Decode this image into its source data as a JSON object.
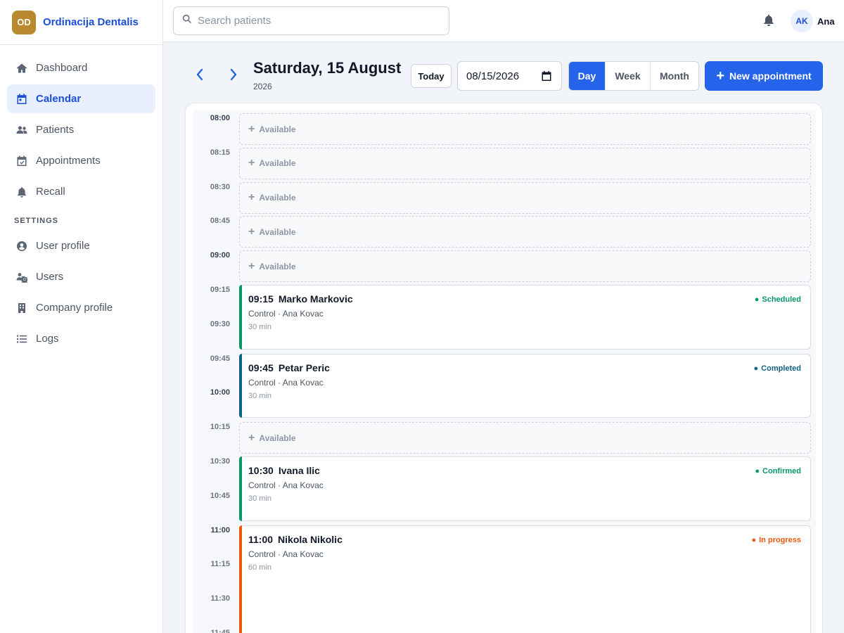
{
  "brand": {
    "initials": "OD",
    "name": "Ordinacija Dentalis"
  },
  "nav": {
    "items": [
      {
        "label": "Dashboard",
        "icon": "home-icon"
      },
      {
        "label": "Calendar",
        "icon": "calendar-icon",
        "active": true
      },
      {
        "label": "Patients",
        "icon": "users-icon"
      },
      {
        "label": "Appointments",
        "icon": "calendar-check-icon"
      },
      {
        "label": "Recall",
        "icon": "bell-icon"
      }
    ],
    "settings_label": "SETTINGS",
    "settings_items": [
      {
        "label": "User profile",
        "icon": "user-circle-icon"
      },
      {
        "label": "Users",
        "icon": "users-cog-icon"
      },
      {
        "label": "Company profile",
        "icon": "building-icon"
      },
      {
        "label": "Logs",
        "icon": "list-icon"
      }
    ]
  },
  "topbar": {
    "search_placeholder": "Search patients",
    "user_initials": "AK",
    "user_name": "Ana"
  },
  "header": {
    "date_title": "Saturday, 15 August",
    "date_year": "2026",
    "today_label": "Today",
    "date_value": "08/15/2026",
    "views": [
      "Day",
      "Week",
      "Month"
    ],
    "active_view": "Day",
    "new_label": "New appointment"
  },
  "colors": {
    "primary": "#2563eb",
    "scheduled": "#059669",
    "completed": "#0e5f8a",
    "confirmed": "#059669",
    "in_progress": "#ea580c"
  },
  "calendar": {
    "time_labels": [
      "08:00",
      "08:15",
      "08:30",
      "08:45",
      "09:00",
      "09:15",
      "09:30",
      "09:45",
      "10:00",
      "10:15",
      "10:30",
      "10:45",
      "11:00",
      "11:15",
      "11:30",
      "11:45"
    ],
    "available_label": "Available",
    "available_slots": [
      "08:00",
      "08:15",
      "08:30",
      "08:45",
      "09:00",
      "10:15"
    ],
    "appointments": [
      {
        "time": "09:15",
        "patient": "Marko Markovic",
        "type": "Control",
        "doctor": "Ana Kovac",
        "duration": "30 min",
        "status": "Scheduled",
        "status_key": "scheduled"
      },
      {
        "time": "09:45",
        "patient": "Petar Peric",
        "type": "Control",
        "doctor": "Ana Kovac",
        "duration": "30 min",
        "status": "Completed",
        "status_key": "completed"
      },
      {
        "time": "10:30",
        "patient": "Ivana Ilic",
        "type": "Control",
        "doctor": "Ana Kovac",
        "duration": "30 min",
        "status": "Confirmed",
        "status_key": "confirmed"
      },
      {
        "time": "11:00",
        "patient": "Nikola Nikolic",
        "type": "Control",
        "doctor": "Ana Kovac",
        "duration": "60 min",
        "status": "In progress",
        "status_key": "in_progress"
      }
    ]
  }
}
